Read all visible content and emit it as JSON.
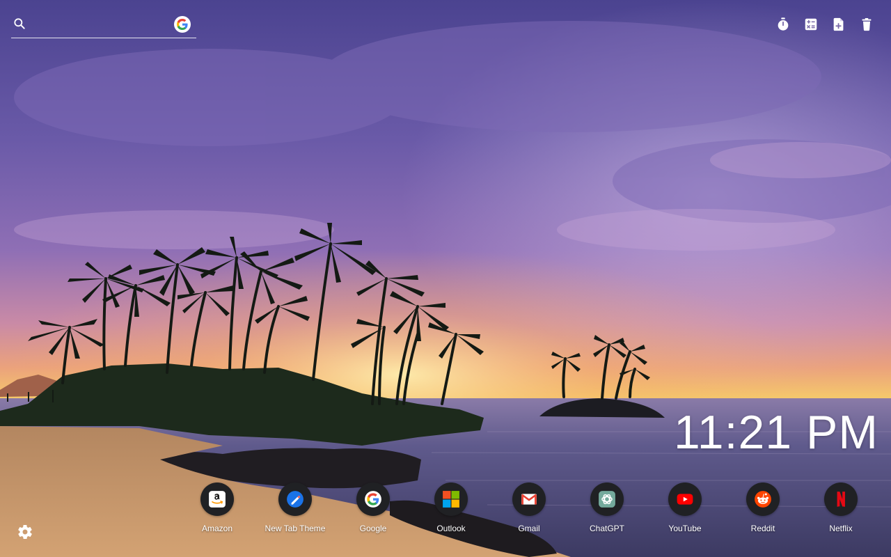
{
  "search": {
    "value": "",
    "placeholder": "",
    "engine_icon": "google-icon"
  },
  "toolbar": {
    "items": [
      {
        "icon": "stopwatch-icon"
      },
      {
        "icon": "calculator-icon"
      },
      {
        "icon": "add-note-icon"
      },
      {
        "icon": "trash-icon"
      }
    ]
  },
  "clock": {
    "time": "11:21 PM"
  },
  "shortcuts": [
    {
      "label": "Amazon",
      "icon": "amazon-icon"
    },
    {
      "label": "New Tab Theme",
      "icon": "new-tab-theme-icon"
    },
    {
      "label": "Google",
      "icon": "google-icon"
    },
    {
      "label": "Outlook",
      "icon": "microsoft-icon"
    },
    {
      "label": "Gmail",
      "icon": "gmail-icon"
    },
    {
      "label": "ChatGPT",
      "icon": "chatgpt-icon"
    },
    {
      "label": "YouTube",
      "icon": "youtube-icon"
    },
    {
      "label": "Reddit",
      "icon": "reddit-icon"
    },
    {
      "label": "Netflix",
      "icon": "netflix-icon"
    }
  ],
  "settings": {
    "icon": "gear-icon"
  },
  "colors": {
    "shortcut_bg": "#202124",
    "text": "#ffffff",
    "sky_top": "#5a4a9c",
    "sunset_glow": "#f4c25a",
    "sea": "#4f4f7c",
    "sand": "#c89866"
  }
}
